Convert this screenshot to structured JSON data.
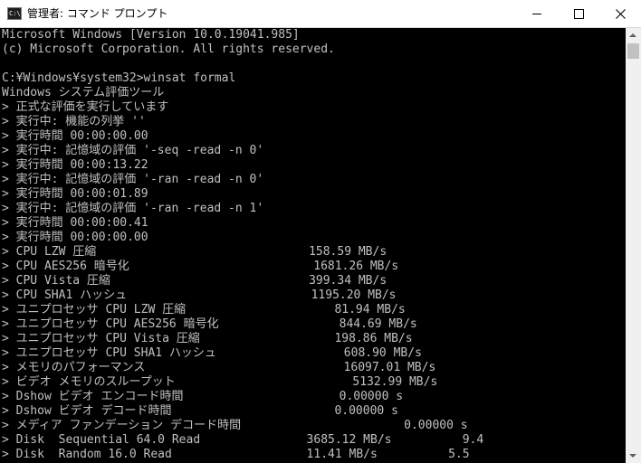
{
  "window": {
    "icon_text": "C:\\.",
    "title": "管理者: コマンド プロンプト",
    "colors": {
      "background": "#000000",
      "text": "#c0c0c0",
      "titlebar": "#ffffff"
    }
  },
  "console": {
    "lines": [
      "Microsoft Windows [Version 10.0.19041.985]",
      "(c) Microsoft Corporation. All rights reserved.",
      "",
      "C:¥Windows¥system32>winsat formal",
      "Windows システム評価ツール",
      "> 正式な評価を実行しています",
      "> 実行中: 機能の列挙 ''",
      "> 実行時間 00:00:00.00",
      "> 実行中: 記憶域の評価 '-seq -read -n 0'",
      "> 実行時間 00:00:13.22",
      "> 実行中: 記憶域の評価 '-ran -read -n 0'",
      "> 実行時間 00:00:01.89",
      "> 実行中: 記憶域の評価 '-ran -read -n 1'",
      "> 実行時間 00:00:00.41",
      "> 実行時間 00:00:00.00",
      "> CPU LZW 圧縮                              158.59 MB/s",
      "> CPU AES256 暗号化                          1681.26 MB/s",
      "> CPU Vista 圧縮                            399.34 MB/s",
      "> CPU SHA1 ハッシュ                          1195.20 MB/s",
      "> ユニプロセッサ CPU LZW 圧縮                     81.94 MB/s",
      "> ユニプロセッサ CPU AES256 暗号化                 844.69 MB/s",
      "> ユニプロセッサ CPU Vista 圧縮                   198.86 MB/s",
      "> ユニプロセッサ CPU SHA1 ハッシュ                  608.90 MB/s",
      "> メモリのパフォーマンス                            16097.01 MB/s",
      "> ビデオ メモリのスループット                         5132.99 MB/s",
      "> Dshow ビデオ エンコード時間                      0.00000 s",
      "> Dshow ビデオ デコード時間                       0.00000 s",
      "> メディア ファンデーション デコード時間                       0.00000 s",
      "> Disk  Sequential 64.0 Read               3685.12 MB/s          9.4",
      "> Disk  Random 16.0 Read                   11.41 MB/s          5.5"
    ]
  }
}
